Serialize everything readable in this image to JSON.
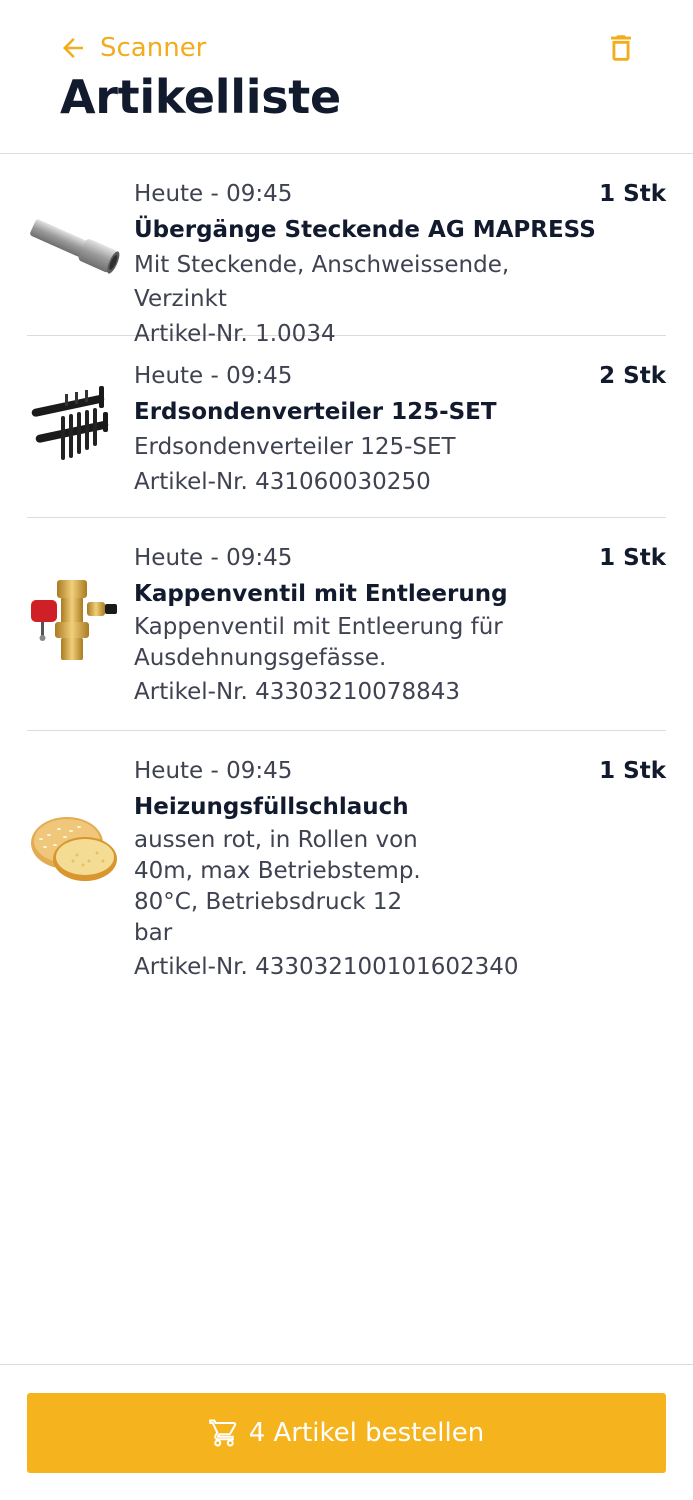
{
  "header": {
    "back_label": "Scanner",
    "title": "Artikelliste"
  },
  "items": [
    {
      "time": "Heute - 09:45",
      "name": "Übergänge Steckende AG MAPRESS",
      "desc": "Mit Steckende, Anschweissende, Verzinkt",
      "artnr": "Artikel-Nr. 1.0034",
      "qty": "1 Stk",
      "image": "steel-pipe-fitting"
    },
    {
      "time": "Heute - 09:45",
      "name": "Erdsondenverteiler 125-SET",
      "desc": "Erdsondenverteiler 125-SET",
      "artnr": "Artikel-Nr. 431060030250",
      "qty": "2 Stk",
      "image": "black-manifold"
    },
    {
      "time": "Heute - 09:45",
      "name": "Kappenventil mit Entleerung",
      "desc": "Kappenventil mit Entleerung für Ausdehnungsgefässe.",
      "artnr": "Artikel-Nr. 43303210078843",
      "qty": "1 Stk",
      "image": "brass-valve"
    },
    {
      "time": "Heute - 09:45",
      "name": "Heizungsfüllschlauch",
      "desc": "aussen rot, in Rollen von 40m, max Betriebstemp. 80°C, Betriebsdruck 12 bar",
      "artnr": "Artikel-Nr. 433032100101602340",
      "qty": "1 Stk",
      "image": "sesame-bun"
    }
  ],
  "footer": {
    "order_label": "4 Artikel bestellen"
  },
  "colors": {
    "accent": "#f5b31e",
    "title": "#121a2e",
    "text": "#3f4250",
    "divider": "#dcdcdc"
  },
  "icons": {
    "back": "arrow-left-icon",
    "delete": "trash-icon",
    "cart": "cart-icon"
  }
}
